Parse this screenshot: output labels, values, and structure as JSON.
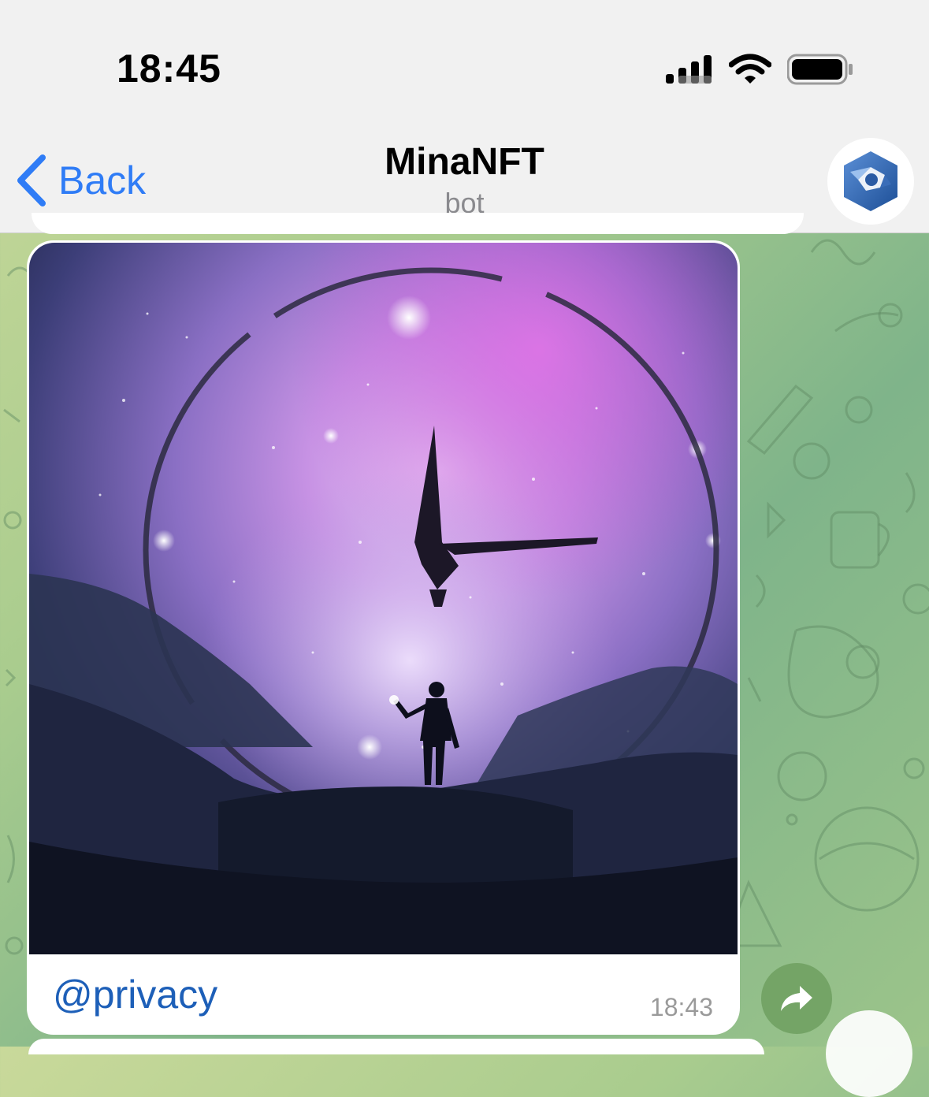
{
  "status_bar": {
    "time": "18:45",
    "icons": [
      "cellular-signal-icon",
      "wifi-icon",
      "battery-icon"
    ]
  },
  "nav": {
    "back_label": "Back",
    "title": "MinaNFT",
    "subtitle": "bot"
  },
  "message": {
    "caption": "@privacy",
    "time": "18:43",
    "image_alt": "Silhouette holding a torch beneath a giant cosmic clock in a purple galaxy sky"
  },
  "colors": {
    "accent": "#2f7cf6",
    "link": "#1d5fb8",
    "share": "#74a466"
  }
}
